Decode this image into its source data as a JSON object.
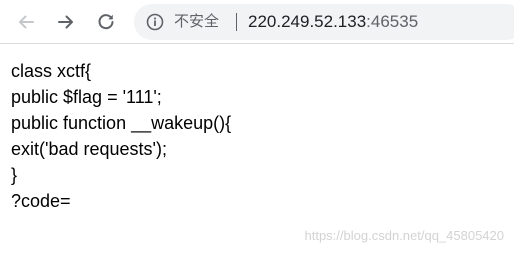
{
  "browser": {
    "security_label": "不安全",
    "url_host": "220.249.52.133",
    "url_port": ":46535"
  },
  "page": {
    "lines": [
      "class xctf{",
      "public $flag = '111';",
      "public function __wakeup(){",
      "exit('bad requests');",
      "}",
      "?code="
    ]
  },
  "watermark": "https://blog.csdn.net/qq_45805420",
  "icons": {
    "back": "arrow-left",
    "forward": "arrow-right",
    "reload": "reload",
    "info": "info-circle"
  }
}
